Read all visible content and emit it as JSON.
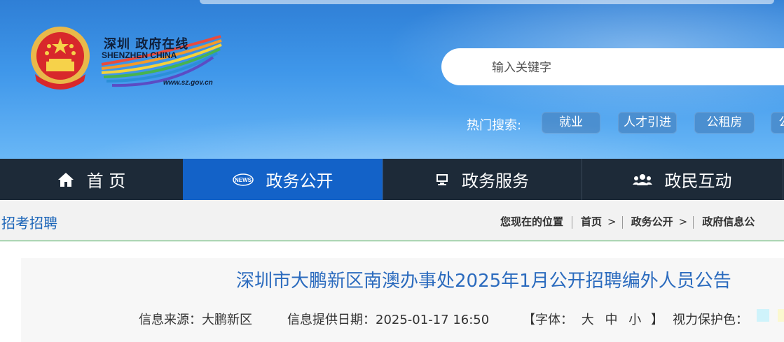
{
  "site": {
    "logo_cn": "深圳 政府在线",
    "logo_en": "SHENZHEN CHINA",
    "logo_url": "www.sz.gov.cn"
  },
  "search": {
    "placeholder": "输入关键字"
  },
  "hot_search": {
    "label": "热门搜索:",
    "tags": [
      "就业",
      "人才引进",
      "公租房",
      "公"
    ]
  },
  "nav": {
    "items": [
      {
        "label": "首 页",
        "icon": "home-icon"
      },
      {
        "label": "政务公开",
        "icon": "news-icon"
      },
      {
        "label": "政务服务",
        "icon": "monitor-icon"
      },
      {
        "label": "政民互动",
        "icon": "people-icon"
      }
    ],
    "active_index": 1
  },
  "breadcrumb": {
    "section_title": "招考招聘",
    "location_label": "您现在的位置",
    "items": [
      "首页",
      "政务公开",
      "政府信息公"
    ],
    "separator": ">"
  },
  "article": {
    "title": "深圳市大鹏新区南澳办事处2025年1月公开招聘编外人员公告",
    "source_label": "信息来源：大鹏新区",
    "date_label": "信息提供日期：2025-01-17 16:50",
    "font_label_open": "【字体：",
    "font_sizes": [
      "大",
      "中",
      "小"
    ],
    "font_label_close": "】",
    "eye_label": "视力保护色：",
    "eye_colors": [
      "#cff3fb",
      "#fbf8cf"
    ]
  },
  "colors": {
    "nav_bg": "#1d2a38",
    "nav_active": "#1362c8",
    "title_blue": "#2b6bbe",
    "section_blue": "#1a64b8"
  }
}
